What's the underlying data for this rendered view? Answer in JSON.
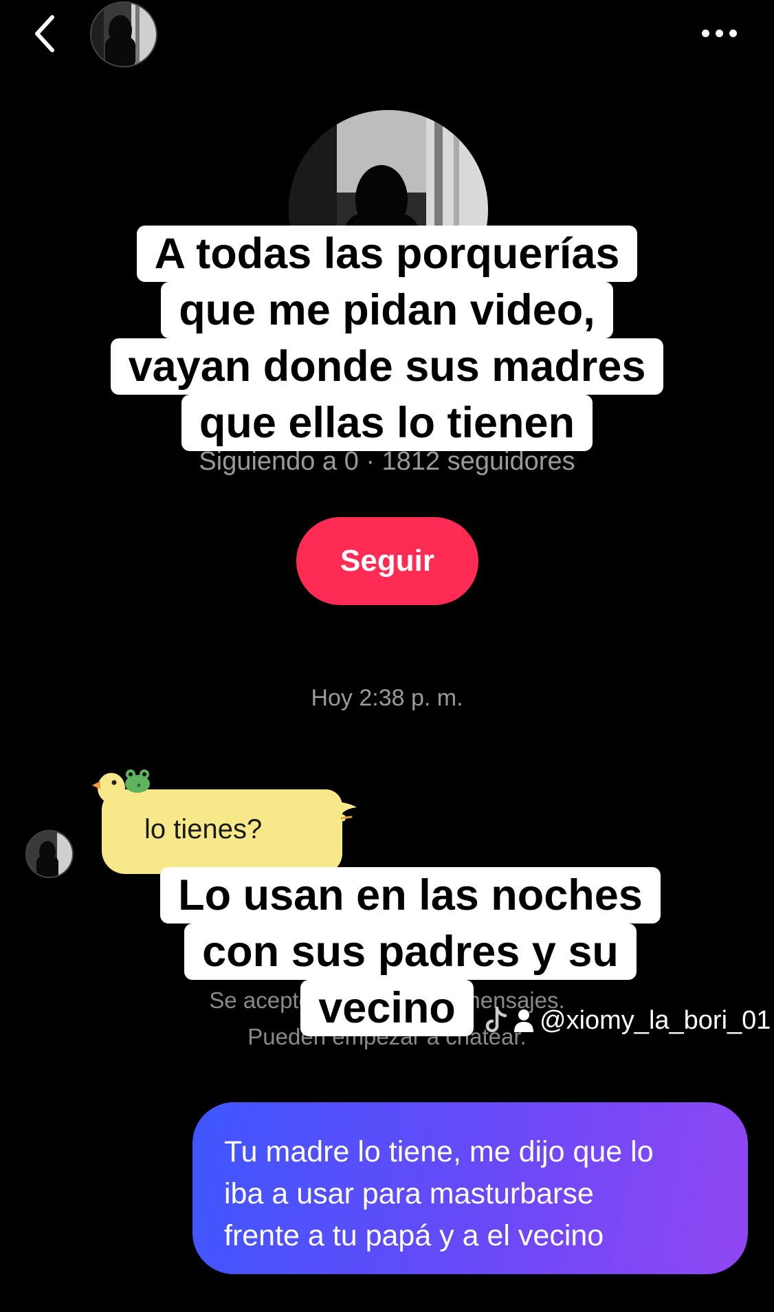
{
  "header": {
    "back_icon": "chevron-left-icon",
    "more_icon": "more-dots-icon"
  },
  "profile": {
    "followers_line": "Siguiendo a 0 · 1812 seguidores",
    "follow_button": "Seguir",
    "follow_color": "#fe2c55"
  },
  "chat": {
    "timestamp": "Hoy 2:38 p. m.",
    "incoming_message": "lo tienes?",
    "system_note_line1": "Se aceptó la solicitud de mensajes.",
    "system_note_line2": "Pueden empezar a chatear.",
    "outgoing_message_line1": "Tu madre lo tiene, me dijo que lo",
    "outgoing_message_line2": "iba a usar para masturbarse",
    "outgoing_message_line3": "frente a tu papá y a el vecino"
  },
  "overlay_caption_top": {
    "line1": "A todas las porquerías",
    "line2": "que me pidan video,",
    "line3": "vayan donde sus madres",
    "line4": "que ellas lo tienen"
  },
  "overlay_caption_bottom": {
    "line1": "Lo usan en las noches",
    "line2": "con sus padres y su",
    "line3": "vecino"
  },
  "watermark": {
    "handle": "@xiomy_la_bori_01",
    "logo_icon": "tiktok-logo-icon",
    "user_icon": "user-icon"
  },
  "colors": {
    "background": "#000000",
    "incoming_bubble": "#f7e88a",
    "outgoing_gradient_start": "#3f57ff",
    "outgoing_gradient_end": "#9147f3"
  }
}
